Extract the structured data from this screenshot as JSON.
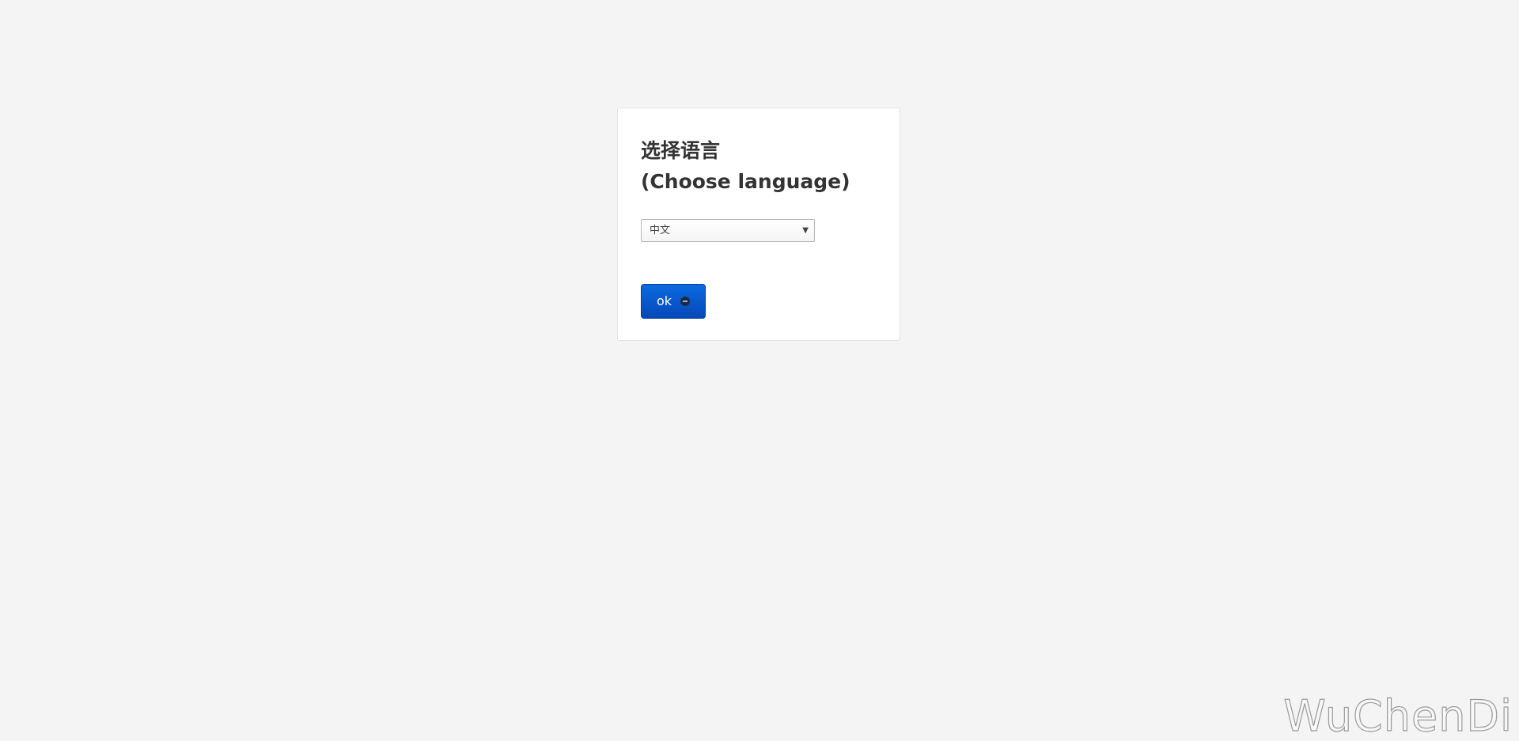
{
  "dialog": {
    "title_line1": "选择语言",
    "title_line2": "(Choose language)",
    "language_select": {
      "selected": "中文",
      "arrow_icon": "dropdown-triangle"
    },
    "ok_button": {
      "label": "ok",
      "icon": "circle-arrow-icon"
    }
  },
  "watermark": "WuChenDi",
  "colors": {
    "background": "#f4f4f4",
    "button": "#0a5bd0"
  }
}
